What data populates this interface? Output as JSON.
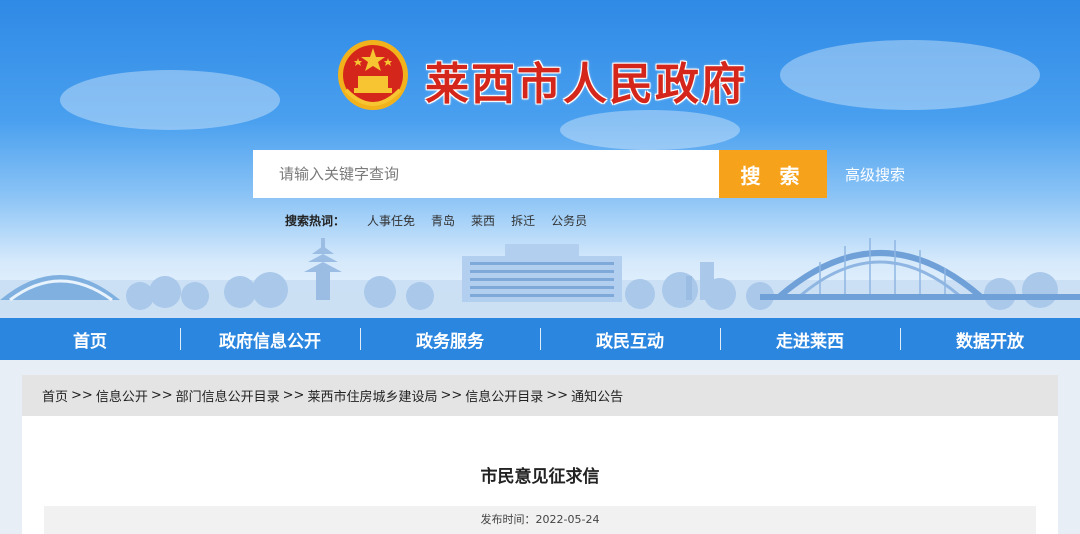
{
  "header": {
    "site_title": "莱西市人民政府",
    "search_placeholder": "请输入关键字查询",
    "search_button": "搜 索",
    "advanced_search": "高级搜索",
    "hot_label": "搜索热词：",
    "hot_words": [
      "人事任免",
      "青岛",
      "莱西",
      "拆迁",
      "公务员"
    ]
  },
  "nav": {
    "items": [
      "首页",
      "政府信息公开",
      "政务服务",
      "政民互动",
      "走进莱西",
      "数据开放"
    ]
  },
  "breadcrumb": {
    "items": [
      "首页",
      "信息公开",
      "部门信息公开目录",
      "莱西市住房城乡建设局",
      "信息公开目录",
      "通知公告"
    ],
    "separator": ">>"
  },
  "article": {
    "title": "市民意见征求信",
    "publish_time": "发布时间：2022-05-24"
  },
  "colors": {
    "title_red": "#d5261c",
    "nav_blue": "#2b86e0",
    "search_orange": "#f7a21b"
  }
}
